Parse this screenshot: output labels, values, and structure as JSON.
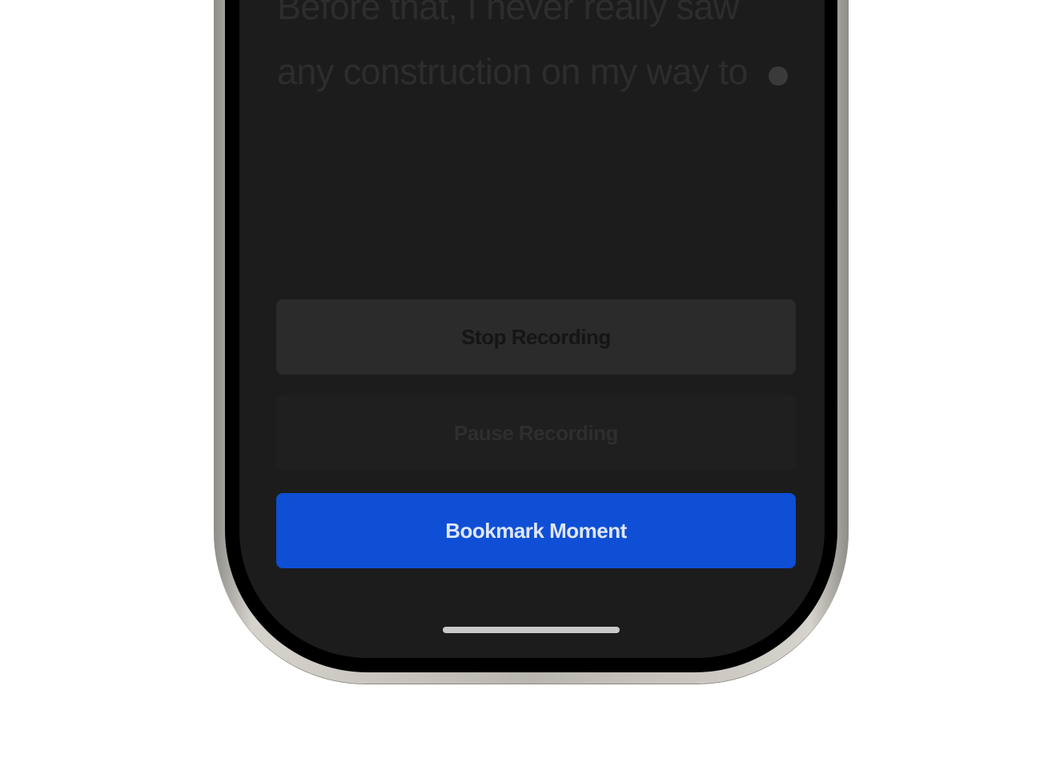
{
  "transcript": {
    "text": "Before that, I never really saw any construction on my way to"
  },
  "buttons": {
    "stop_label": "Stop Recording",
    "pause_label": "Pause Recording",
    "bookmark_label": "Bookmark Moment"
  },
  "colors": {
    "screen_background": "#1c1c1c",
    "bookmark_accent": "#0e4fd6",
    "stop_background": "#2b2b2b",
    "pause_background": "#1f1f1f",
    "frame": "#b9b6b0"
  }
}
